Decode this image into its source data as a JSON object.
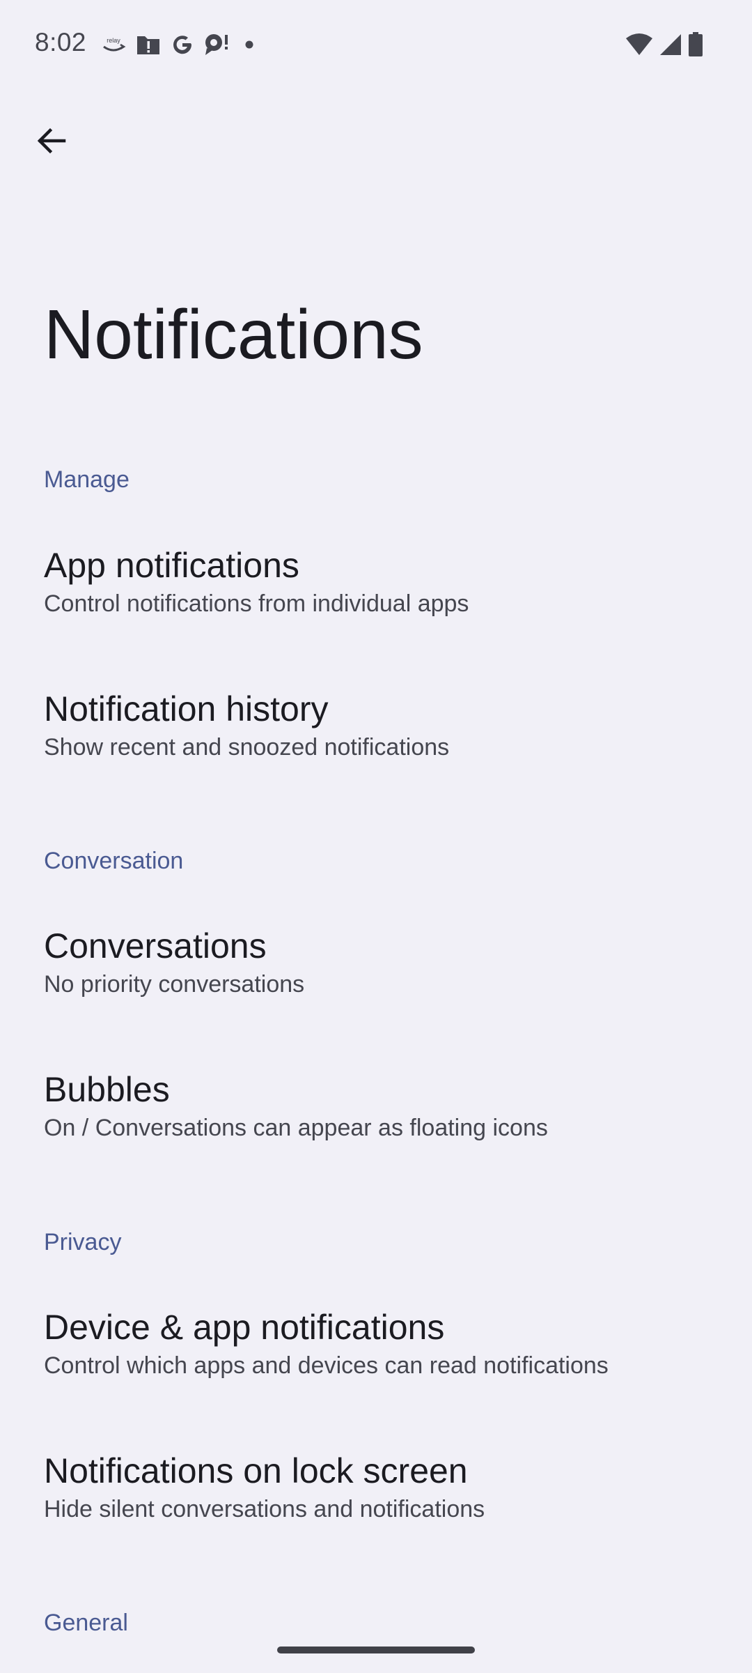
{
  "status_bar": {
    "time": "8:02",
    "notification_icons": [
      "relay-icon",
      "alert-folder-icon",
      "google-icon",
      "chat-alert-icon",
      "more-dot-icon"
    ],
    "system_icons": [
      "wifi-icon",
      "cellular-signal-icon",
      "battery-icon"
    ]
  },
  "header": {
    "title": "Notifications"
  },
  "sections": {
    "manage": {
      "label": "Manage",
      "items": [
        {
          "title": "App notifications",
          "summary": "Control notifications from individual apps"
        },
        {
          "title": "Notification history",
          "summary": "Show recent and snoozed notifications"
        }
      ]
    },
    "conversation": {
      "label": "Conversation",
      "items": [
        {
          "title": "Conversations",
          "summary": "No priority conversations"
        },
        {
          "title": "Bubbles",
          "summary": "On / Conversations can appear as floating icons"
        }
      ]
    },
    "privacy": {
      "label": "Privacy",
      "items": [
        {
          "title": "Device & app notifications",
          "summary": "Control which apps and devices can read notifications"
        },
        {
          "title": "Notifications on lock screen",
          "summary": "Hide silent conversations and notifications"
        }
      ]
    },
    "general": {
      "label": "General"
    }
  },
  "colors": {
    "background": "#f1f0f7",
    "accent": "#4a5a92",
    "text_primary": "#1b1b21",
    "text_secondary": "#45464f"
  }
}
